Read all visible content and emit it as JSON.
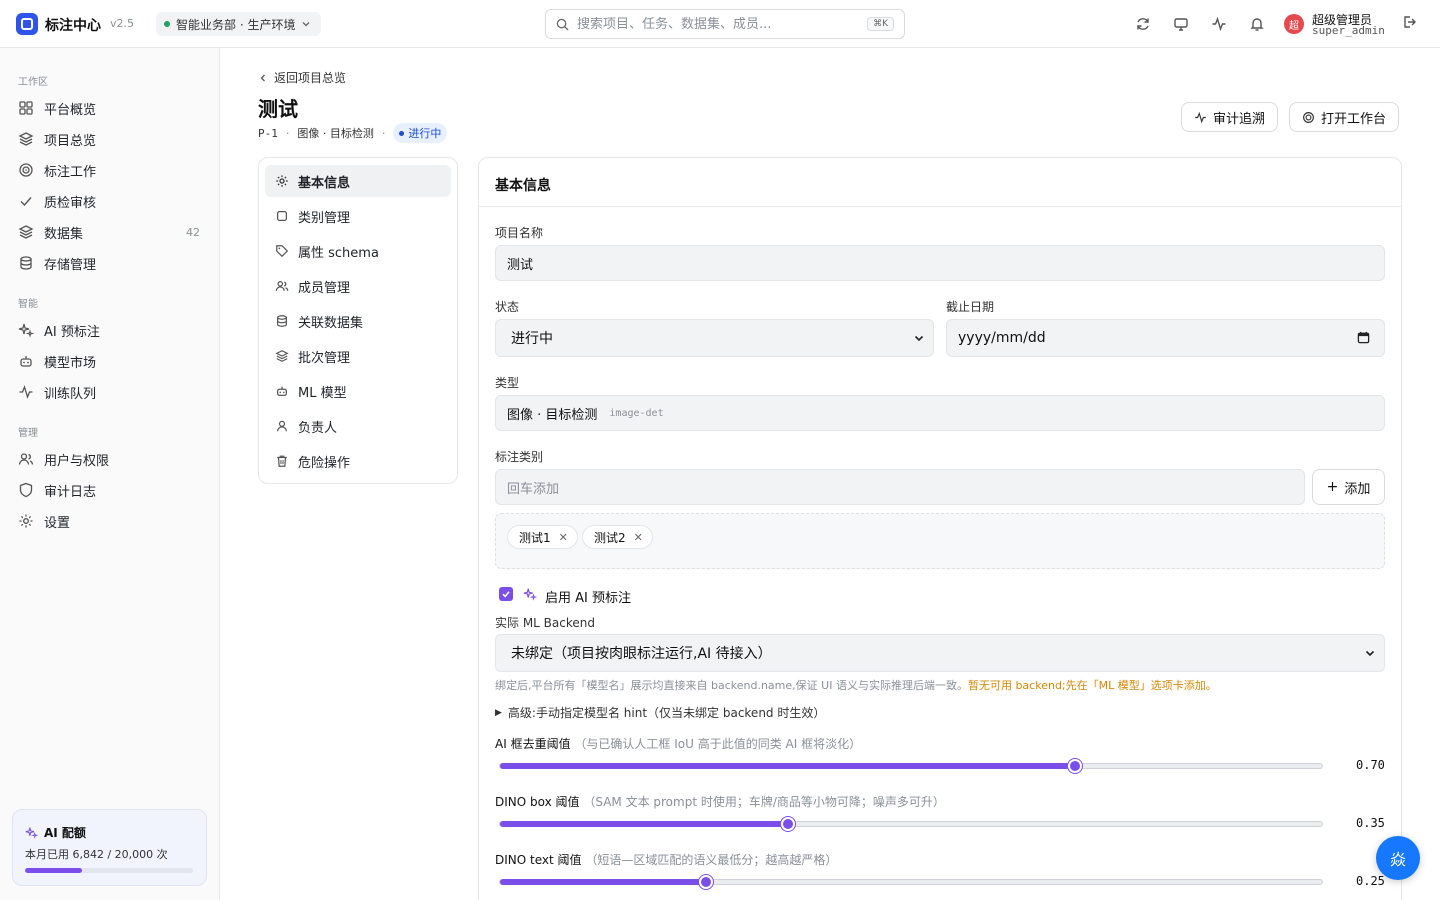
{
  "app": {
    "title": "标注中心",
    "version": "v2.5",
    "environment": "智能业务部 · 生产环境"
  },
  "search": {
    "placeholder": "搜索项目、任务、数据集、成员...",
    "shortcut": "⌘K"
  },
  "user": {
    "avatar_text": "超",
    "name": "超级管理员",
    "id": "super_admin"
  },
  "sidebar": {
    "groups": [
      {
        "label": "工作区",
        "items": [
          {
            "label": "平台概览",
            "icon": "grid-icon"
          },
          {
            "label": "项目总览",
            "icon": "layers-icon"
          },
          {
            "label": "标注工作",
            "icon": "target-icon"
          },
          {
            "label": "质检审核",
            "icon": "check-icon"
          },
          {
            "label": "数据集",
            "icon": "layers-icon",
            "count": "42"
          },
          {
            "label": "存储管理",
            "icon": "database-icon"
          }
        ]
      },
      {
        "label": "智能",
        "items": [
          {
            "label": "AI 预标注",
            "icon": "sparkles-icon"
          },
          {
            "label": "模型市场",
            "icon": "robot-icon"
          },
          {
            "label": "训练队列",
            "icon": "activity-icon"
          }
        ]
      },
      {
        "label": "管理",
        "items": [
          {
            "label": "用户与权限",
            "icon": "users-icon"
          },
          {
            "label": "审计日志",
            "icon": "shield-icon"
          },
          {
            "label": "设置",
            "icon": "gear-icon"
          }
        ]
      }
    ],
    "quota": {
      "title": "AI 配额",
      "text": "本月已用 6,842 / 20,000 次",
      "used": 6842,
      "total": 20000
    }
  },
  "header": {
    "back": "返回项目总览",
    "title": "测试",
    "id": "P-1",
    "type": "图像 · 目标检测",
    "status": "进行中",
    "audit_btn": "审计追溯",
    "workbench_btn": "打开工作台"
  },
  "subnav": [
    {
      "label": "基本信息",
      "icon": "gear-icon",
      "active": true
    },
    {
      "label": "类别管理",
      "icon": "square-icon"
    },
    {
      "label": "属性 schema",
      "icon": "tag-icon"
    },
    {
      "label": "成员管理",
      "icon": "users-icon"
    },
    {
      "label": "关联数据集",
      "icon": "database-icon"
    },
    {
      "label": "批次管理",
      "icon": "layers-icon"
    },
    {
      "label": "ML 模型",
      "icon": "robot-icon"
    },
    {
      "label": "负责人",
      "icon": "user-icon"
    },
    {
      "label": "危险操作",
      "icon": "trash-icon"
    }
  ],
  "form": {
    "section_title": "基本信息",
    "name_label": "项目名称",
    "name_value": "测试",
    "status_label": "状态",
    "status_value": "进行中",
    "due_label": "截止日期",
    "due_placeholder": "yyyy/mm/dd",
    "type_label": "类型",
    "type_value": "图像 · 目标检测",
    "type_code": "image-det",
    "classes_label": "标注类别",
    "classes_placeholder": "回车添加",
    "add_btn": "添加",
    "classes": [
      "测试1",
      "测试2"
    ],
    "ai_label": "启用 AI 预标注",
    "ai_enabled": true,
    "backend_label": "实际 ML Backend",
    "backend_value": "未绑定（项目按肉眼标注运行,AI 待接入）",
    "backend_help": "绑定后,平台所有「模型名」展示均直接来自 backend.name,保证 UI 语义与实际推理后端一致。",
    "backend_warn": "暂无可用 backend;先在「ML 模型」选项卡添加。",
    "advanced_label": "高级:手动指定模型名 hint（仅当未绑定 backend 时生效）",
    "sliders": [
      {
        "name": "AI 框去重阈值",
        "desc": "（与已确认人工框 IoU 高于此值的同类 AI 框将淡化）",
        "value": 0.7,
        "display": "0.70"
      },
      {
        "name": "DINO box 阈值",
        "desc": "（SAM 文本 prompt 时使用；车牌/商品等小物可降；噪声多可升）",
        "value": 0.35,
        "display": "0.35"
      },
      {
        "name": "DINO text 阈值",
        "desc": "（短语—区域匹配的语义最低分；越高越严格）",
        "value": 0.25,
        "display": "0.25"
      }
    ]
  },
  "fab": {
    "label": "焱"
  },
  "colors": {
    "accent": "#7a4ee8",
    "primary": "#1677ff",
    "brand": "#2f54eb",
    "warning": "#d48806"
  }
}
